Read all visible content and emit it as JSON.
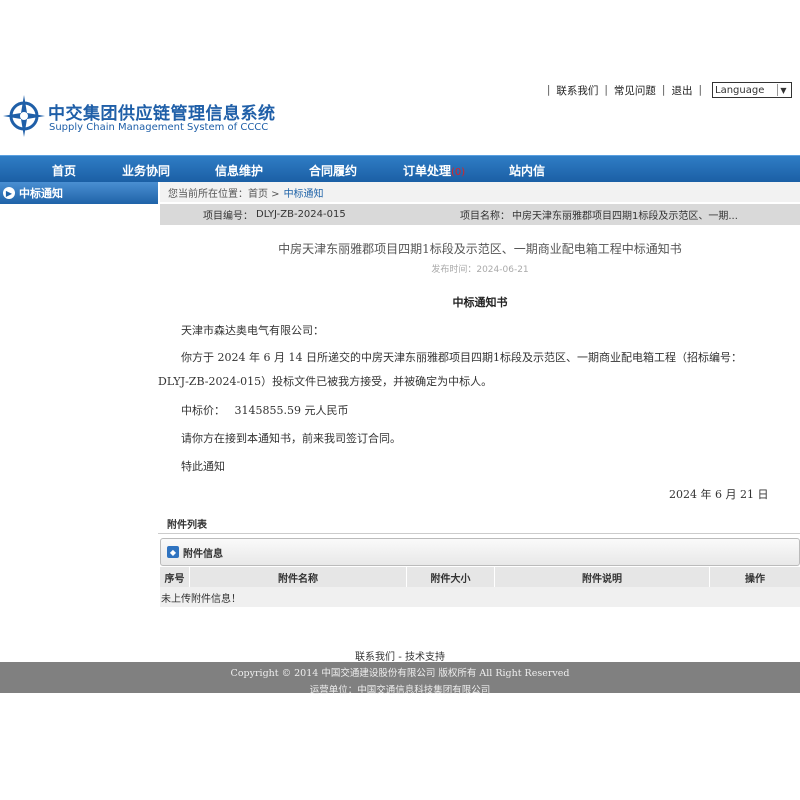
{
  "header": {
    "logo_cn": "中交集团供应链管理信息系统",
    "logo_en": "Supply Chain Management System of CCCC",
    "links": [
      "联系我们",
      "常见问题",
      "退出"
    ],
    "language": "Language"
  },
  "nav": [
    "首页",
    "业务协同",
    "信息维护",
    "合同履约",
    "订单处理",
    "站内信"
  ],
  "nav_badge": "(0)",
  "sidebar": {
    "title": "中标通知"
  },
  "breadcrumb": {
    "prefix": "您当前所在位置：首页 >",
    "current": "中标通知"
  },
  "project": {
    "code_label": "项目编号：",
    "code": "DLYJ-ZB-2024-015",
    "name_label": "项目名称：",
    "name": "中房天津东丽雅郡项目四期1标段及示范区、一期..."
  },
  "main_title": "中房天津东丽雅郡项目四期1标段及示范区、一期商业配电箱工程中标通知书",
  "publish_time": "发布时间：2024-06-21",
  "notice": {
    "title": "中标通知书",
    "recipient": "天津市森达奥电气有限公司：",
    "body": "你方于  2024 年  6 月  14 日所递交的中房天津东丽雅郡项目四期1标段及示范区、一期商业配电箱工程（招标编号：DLYJ-ZB-2024-015）投标文件已被我方接受，并被确定为中标人。",
    "price_label": "中标价：",
    "price": "3145855.59 元人民币",
    "instruction": "请你方在接到本通知书，前来我司签订合同。",
    "closing": "特此通知",
    "date": "2024 年  6 月  21 日"
  },
  "attachments": {
    "section_label": "附件列表",
    "box_title": "附件信息",
    "columns": [
      "序号",
      "附件名称",
      "附件大小",
      "附件说明",
      "操作"
    ],
    "empty": "未上传附件信息！"
  },
  "footer": {
    "links": "联系我们 - 技术支持",
    "copyright": "Copyright © 2014 中国交通建设股份有限公司  版权所有  All Right Reserved",
    "operator": "运营单位：中国交通信息科技集团有限公司"
  },
  "colors": {
    "nav_blue": "#1f63a8",
    "footer_gray": "#808080"
  }
}
